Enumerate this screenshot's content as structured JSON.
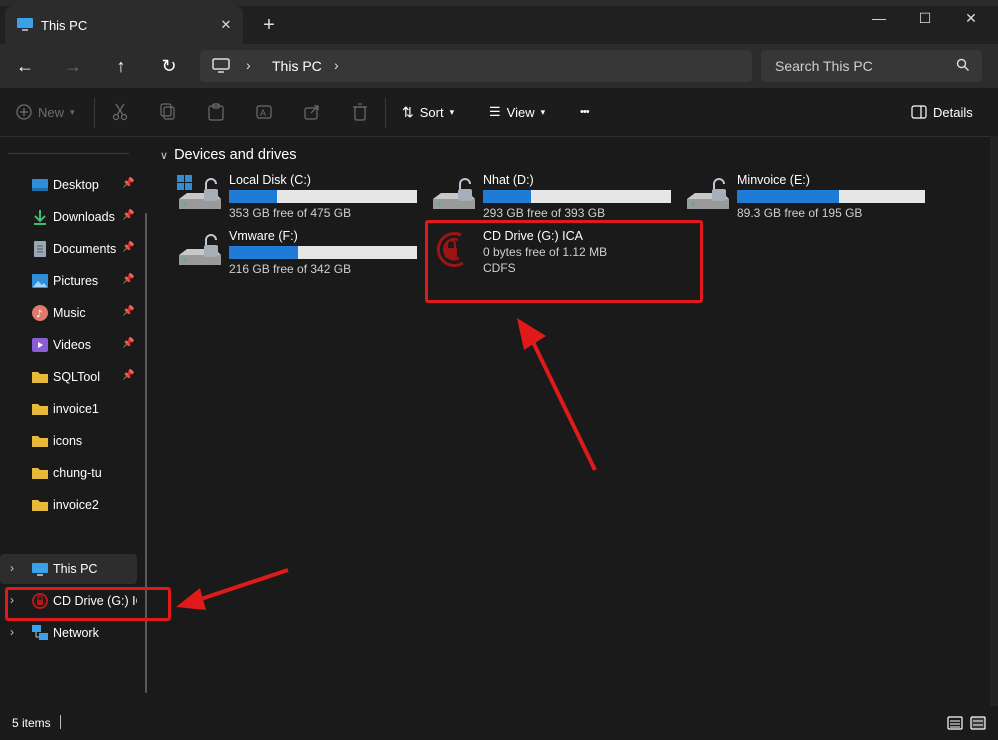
{
  "window": {
    "tab_title": "This PC",
    "tab_close": "✕",
    "new_tab": "+",
    "minimize": "—",
    "maximize": "☐",
    "close": "✕"
  },
  "nav": {
    "back": "←",
    "forward": "→",
    "up": "↑",
    "refresh": "↻",
    "breadcrumb": "This PC",
    "search_placeholder": "Search This PC"
  },
  "toolbar": {
    "new_label": "New",
    "sort_label": "Sort",
    "view_label": "View",
    "more_label": "•••",
    "details_label": "Details"
  },
  "sidebar": {
    "quick_access": [
      {
        "label": "Desktop",
        "icon": "desktop-icon",
        "pinned": true
      },
      {
        "label": "Downloads",
        "icon": "downloads-icon",
        "pinned": true
      },
      {
        "label": "Documents",
        "icon": "documents-icon",
        "pinned": true
      },
      {
        "label": "Pictures",
        "icon": "pictures-icon",
        "pinned": true
      },
      {
        "label": "Music",
        "icon": "music-icon",
        "pinned": true
      },
      {
        "label": "Videos",
        "icon": "videos-icon",
        "pinned": true
      },
      {
        "label": "SQLTool",
        "icon": "folder-icon",
        "pinned": true
      },
      {
        "label": "invoice1",
        "icon": "folder-icon",
        "pinned": false
      },
      {
        "label": "icons",
        "icon": "folder-icon",
        "pinned": false
      },
      {
        "label": "chung-tu",
        "icon": "folder-icon",
        "pinned": false
      },
      {
        "label": "invoice2",
        "icon": "folder-icon",
        "pinned": false
      }
    ],
    "locations": [
      {
        "label": "This PC",
        "icon": "pc-icon"
      },
      {
        "label": "CD Drive (G:) ICA",
        "icon": "cd-lock-icon"
      },
      {
        "label": "Network",
        "icon": "network-icon"
      }
    ]
  },
  "main": {
    "group_title": "Devices and drives",
    "drives": [
      {
        "name": "Local Disk (C:)",
        "free_text": "353 GB free of 475 GB",
        "used_fraction": 0.257
      },
      {
        "name": "Nhat (D:)",
        "free_text": "293 GB free of 393 GB",
        "used_fraction": 0.254
      },
      {
        "name": "Minvoice (E:)",
        "free_text": "89.3 GB free of 195 GB",
        "used_fraction": 0.542
      },
      {
        "name": "Vmware (F:)",
        "free_text": "216 GB free of 342 GB",
        "used_fraction": 0.368
      }
    ],
    "cd_drive": {
      "name": "CD Drive (G:) ICA",
      "free_text": "0 bytes free of 1.12 MB",
      "fs": "CDFS"
    }
  },
  "status": {
    "items_count": "5 items"
  },
  "colors": {
    "accent": "#1e7bd6",
    "annotation": "#e01919",
    "background": "#1a1a1a"
  }
}
